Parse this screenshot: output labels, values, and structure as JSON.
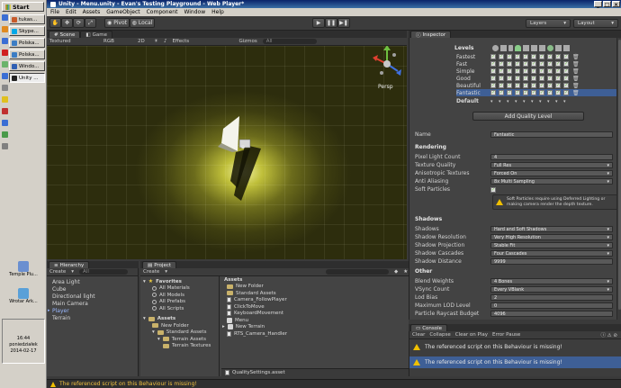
{
  "taskbar": {
    "start_label": "Start",
    "items": [
      {
        "label": "tukas...",
        "color": "#c75a2a"
      },
      {
        "label": "Skype...",
        "color": "#00a8e8"
      },
      {
        "label": "Polska...",
        "color": "#3c7dc4"
      },
      {
        "label": "Polska...",
        "color": "#3c7dc4"
      },
      {
        "label": "Windo...",
        "color": "#2f5fb3"
      },
      {
        "label": "Unity ...",
        "color": "#222222"
      }
    ],
    "desktop_icons": [
      {
        "label": "Temple Plu..."
      },
      {
        "label": "Wrotar Ark..."
      }
    ],
    "clock": {
      "time": "16:44",
      "day": "poniedziałek",
      "date": "2014-02-17"
    }
  },
  "window": {
    "title": "Unity - Menu.unity - Evan's Testing Playground - Web Player*"
  },
  "menu": [
    "File",
    "Edit",
    "Assets",
    "GameObject",
    "Component",
    "Window",
    "Help"
  ],
  "toolbar": {
    "pivot": "Pivot",
    "local": "Local",
    "play": "▶",
    "pause": "❚❚",
    "step": "▶❚",
    "layers": "Layers",
    "layout": "Layout"
  },
  "scene": {
    "tabs": [
      "Scene",
      "Game"
    ],
    "shading": "Textured",
    "render": "RGB",
    "mode2d": "2D",
    "effects": "Effects",
    "gizmos": "Gizmos",
    "search": "All",
    "persp": "Persp"
  },
  "hierarchy": {
    "tab": "Hierarchy",
    "create": "Create",
    "search": "All",
    "items": [
      "Area Light",
      "Cube",
      "Directional light",
      "Main Camera",
      "Player",
      "Terrain"
    ]
  },
  "project": {
    "tab": "Project",
    "create": "Create",
    "favorites_label": "Favorites",
    "favorites": [
      "All Materials",
      "All Models",
      "All Prefabs",
      "All Scripts"
    ],
    "assets_label": "Assets",
    "tree": [
      "New Folder",
      "Standard Assets",
      "Terrain Assets",
      "Terrain Textures"
    ],
    "breadcrumb": "Assets",
    "files": [
      "New Folder",
      "Standard Assets",
      "Camera_FollowPlayer",
      "ClickToMove",
      "KeyboardMovement",
      "Menu",
      "New Terrain",
      "RTS_Camera_Handler"
    ],
    "selected_file": "QualitySettings.asset"
  },
  "inspector": {
    "tab": "Inspector",
    "levels_label": "Levels",
    "levels": [
      "Fastest",
      "Fast",
      "Simple",
      "Good",
      "Beautiful",
      "Fantastic"
    ],
    "default_label": "Default",
    "add_button": "Add Quality Level",
    "name_label": "Name",
    "name_value": "Fantastic",
    "rendering_header": "Rendering",
    "rendering": [
      {
        "label": "Pixel Light Count",
        "value": "4",
        "type": "text"
      },
      {
        "label": "Texture Quality",
        "value": "Full Res",
        "type": "dropdown"
      },
      {
        "label": "Anisotropic Textures",
        "value": "Forced On",
        "type": "dropdown"
      },
      {
        "label": "Anti Aliasing",
        "value": "8x Multi Sampling",
        "type": "dropdown"
      },
      {
        "label": "Soft Particles",
        "value": "✓",
        "type": "check"
      }
    ],
    "soft_particles_warning": "Soft Particles require using Deferred Lighting or making camera render the depth texture.",
    "shadows_header": "Shadows",
    "shadows": [
      {
        "label": "Shadows",
        "value": "Hard and Soft Shadows",
        "type": "dropdown"
      },
      {
        "label": "Shadow Resolution",
        "value": "Very High Resolution",
        "type": "dropdown"
      },
      {
        "label": "Shadow Projection",
        "value": "Stable Fit",
        "type": "dropdown"
      },
      {
        "label": "Shadow Cascades",
        "value": "Four Cascades",
        "type": "dropdown"
      },
      {
        "label": "Shadow Distance",
        "value": "9999",
        "type": "text"
      }
    ],
    "other_header": "Other",
    "other": [
      {
        "label": "Blend Weights",
        "value": "4 Bones",
        "type": "dropdown"
      },
      {
        "label": "VSync Count",
        "value": "Every VBlank",
        "type": "dropdown"
      },
      {
        "label": "Lod Bias",
        "value": "2",
        "type": "text"
      },
      {
        "label": "Maximum LOD Level",
        "value": "0",
        "type": "text"
      },
      {
        "label": "Particle Raycast Budget",
        "value": "4096",
        "type": "text"
      }
    ]
  },
  "console": {
    "tab": "Console",
    "buttons": [
      "Clear",
      "Collapse",
      "Clear on Play",
      "Error Pause"
    ],
    "messages": [
      "The referenced script on this Behaviour is missing!",
      "The referenced script on this Behaviour is missing!"
    ]
  },
  "status": {
    "message": "The referenced script on this Behaviour is missing!"
  },
  "colors": {
    "accent": "#3e5f96",
    "warning": "#f0c000",
    "checkmark": "#6fc040"
  }
}
